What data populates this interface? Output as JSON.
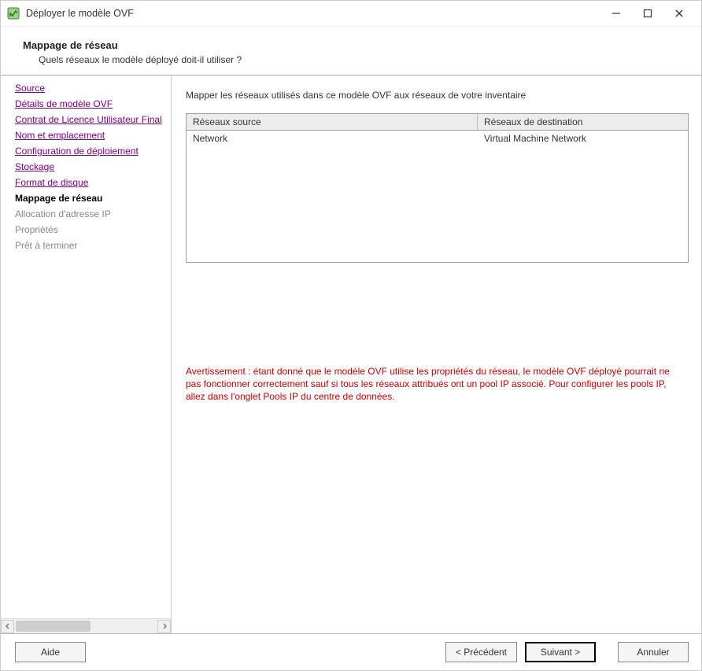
{
  "window": {
    "title": "Déployer le modèle OVF"
  },
  "header": {
    "title": "Mappage de réseau",
    "subtitle": "Quels réseaux le modèle déployé doit-il utiliser ?"
  },
  "sidebar": {
    "items": [
      {
        "label": "Source",
        "state": "visited"
      },
      {
        "label": "Détails de modèle OVF",
        "state": "visited"
      },
      {
        "label": "Contrat de Licence Utilisateur Final",
        "state": "visited"
      },
      {
        "label": "Nom et emplacement",
        "state": "visited"
      },
      {
        "label": "Configuration de déploiement",
        "state": "visited"
      },
      {
        "label": "Stockage",
        "state": "visited"
      },
      {
        "label": "Format de disque",
        "state": "visited"
      },
      {
        "label": "Mappage de réseau",
        "state": "current"
      },
      {
        "label": "Allocation d'adresse IP",
        "state": "future"
      },
      {
        "label": "Propriétés",
        "state": "future"
      },
      {
        "label": "Prêt à terminer",
        "state": "future"
      }
    ]
  },
  "content": {
    "instruction": "Mapper les réseaux utilisés dans ce modèle OVF aux réseaux de votre inventaire",
    "columns": {
      "source": "Réseaux source",
      "destination": "Réseaux de destination"
    },
    "rows": [
      {
        "source": "Network",
        "destination": "Virtual Machine Network"
      }
    ],
    "warning": "Avertissement : étant donné que le modèle OVF utilise les propriétés du réseau, le modèle OVF déployé pourrait ne pas fonctionner correctement sauf si tous les réseaux attribués ont un pool IP associé. Pour configurer les pools IP, allez dans l'onglet Pools IP du centre de données."
  },
  "footer": {
    "help": "Aide",
    "back": "< Précédent",
    "next": "Suivant >",
    "cancel": "Annuler"
  }
}
